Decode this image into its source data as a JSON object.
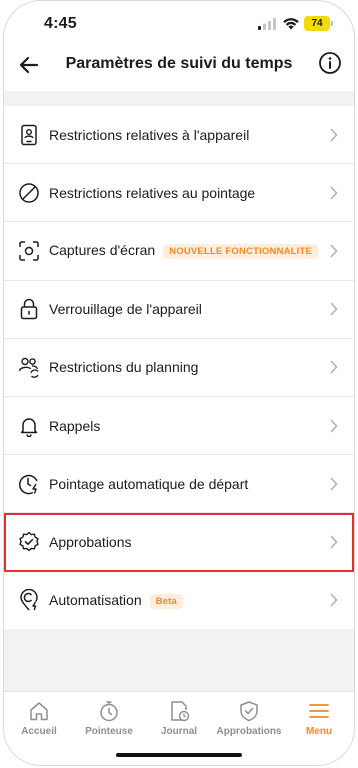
{
  "status_bar": {
    "time": "4:45",
    "battery": "74"
  },
  "header": {
    "title": "Paramètres de suivi du temps",
    "back_icon": "arrow-left-icon",
    "info_icon": "info-circle-icon"
  },
  "settings": [
    {
      "label": "Restrictions relatives à l'appareil",
      "icon": "device-user-icon"
    },
    {
      "label": "Restrictions relatives au pointage",
      "icon": "prohibited-icon"
    },
    {
      "label": "Captures d'écran",
      "icon": "screenshot-icon",
      "badge": "NOUVELLE FONCTIONNALITE"
    },
    {
      "label": "Verrouillage de l'appareil",
      "icon": "lock-icon"
    },
    {
      "label": "Restrictions du planning",
      "icon": "users-sync-icon"
    },
    {
      "label": "Rappels",
      "icon": "bell-icon"
    },
    {
      "label": "Pointage automatique de départ",
      "icon": "clock-lightning-icon"
    },
    {
      "label": "Approbations",
      "icon": "badge-check-icon",
      "highlighted": true
    },
    {
      "label": "Automatisation",
      "icon": "location-automation-icon",
      "badge": "Beta"
    }
  ],
  "tabs": [
    {
      "label": "Accueil",
      "icon": "home-icon"
    },
    {
      "label": "Pointeuse",
      "icon": "stopwatch-icon"
    },
    {
      "label": "Journal",
      "icon": "timesheet-icon"
    },
    {
      "label": "Approbations",
      "icon": "shield-check-icon"
    },
    {
      "label": "Menu",
      "icon": "hamburger-menu-icon",
      "active": true
    }
  ],
  "colors": {
    "accent": "#f08a24",
    "highlight_border": "#e03030",
    "badge_bg": "#fdeede"
  }
}
